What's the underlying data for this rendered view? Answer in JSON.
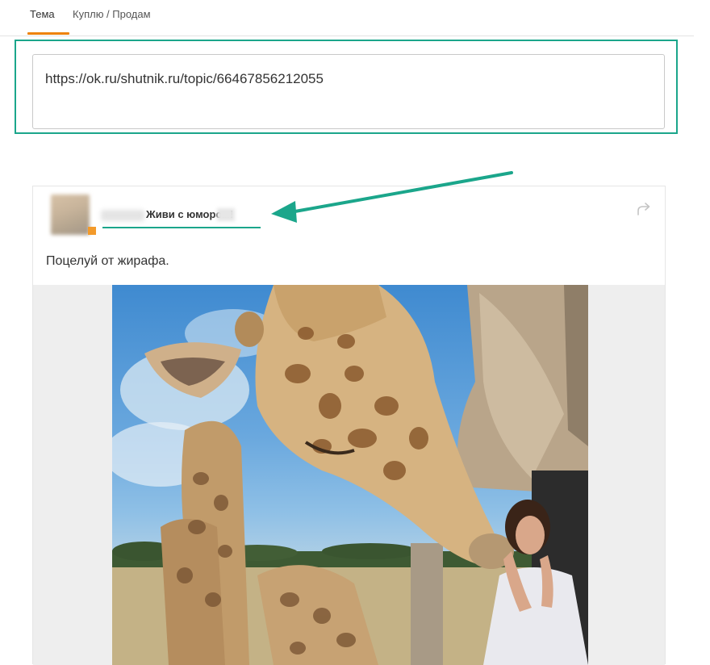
{
  "tabs": [
    {
      "label": "Тема",
      "active": true
    },
    {
      "label": "Куплю / Продам",
      "active": false
    }
  ],
  "url_field": {
    "value": "https://ok.ru/shutnik.ru/topic/66467856212055"
  },
  "post": {
    "group_name": "Живи с юмором!",
    "text": "Поцелуй от жирафа."
  },
  "icons": {
    "share": "share-arrow-icon",
    "avatar": "avatar-image"
  },
  "colors": {
    "accent_tab": "#ee8208",
    "highlight": "#1ba68b",
    "avatar_badge": "#f39a2a"
  }
}
